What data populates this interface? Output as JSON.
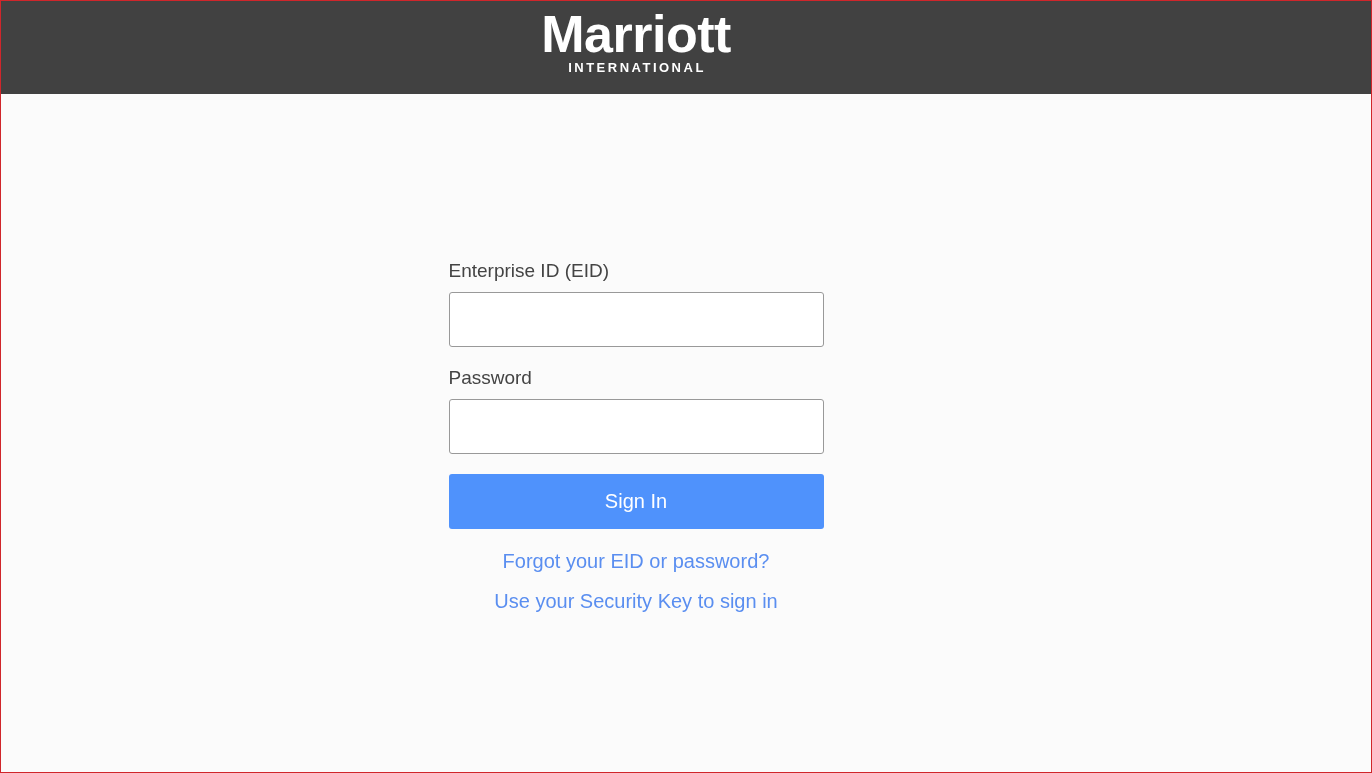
{
  "header": {
    "logo": {
      "wordmark": "Marriott",
      "subtitle": "INTERNATIONAL"
    }
  },
  "form": {
    "fields": [
      {
        "label": "Enterprise ID (EID)"
      },
      {
        "label": "Password"
      }
    ],
    "submit": "Sign In",
    "links": [
      "Forgot your EID or password?",
      "Use your Security Key to sign in"
    ]
  }
}
